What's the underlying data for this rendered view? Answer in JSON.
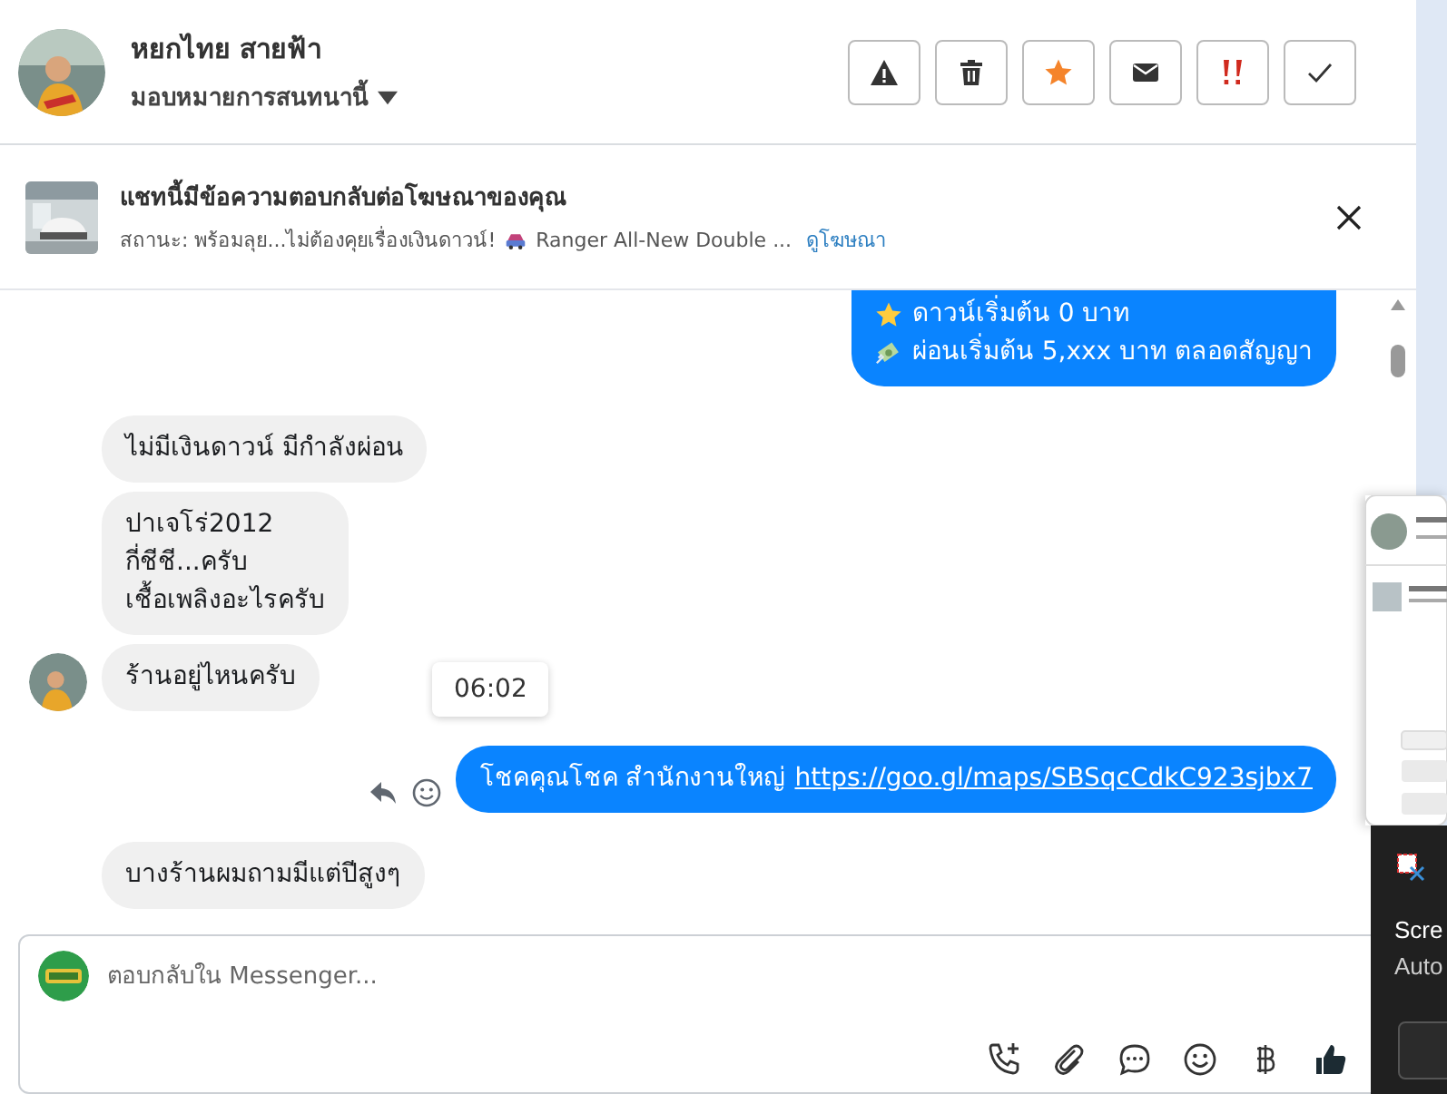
{
  "header": {
    "name": "หยกไทย สายฟ้า",
    "assign": "มอบหมายการสนทนานี้",
    "actions": [
      {
        "kind": "spam"
      },
      {
        "kind": "trash"
      },
      {
        "kind": "star"
      },
      {
        "kind": "mail"
      },
      {
        "kind": "important"
      },
      {
        "kind": "done"
      }
    ]
  },
  "ad_banner": {
    "title": "แชทนี้มีข้อความตอบกลับต่อโฆษณาของคุณ",
    "status": "สถานะ: พร้อมลุย...ไม่ต้องคุยเรื่องเงินดาวน์!",
    "ad_name": "Ranger All-New Double ...",
    "link": "ดูโฆษณา"
  },
  "messages": [
    {
      "kind": "sent",
      "lines": [
        {
          "kind": "star",
          "text": "ดาวน์เริ่มต้น 0 บาท"
        },
        {
          "kind": "money",
          "text": "ผ่อนเริ่มต้น 5,xxx บาท ตลอดสัญญา"
        }
      ]
    },
    {
      "kind": "received",
      "avatar": false,
      "lines": [
        {
          "text": "ไม่มีเงินดาวน์ มีกำลังผ่อน"
        }
      ]
    },
    {
      "kind": "received",
      "avatar": false,
      "lines": [
        {
          "text": "ปาเจโร่2012"
        },
        {
          "text": "กี่ชีชี...ครับ"
        },
        {
          "text": "เชื้อเพลิงอะไรครับ"
        }
      ]
    },
    {
      "kind": "received",
      "avatar": true,
      "lines": [
        {
          "text": "ร้านอยู่ไหนครับ"
        }
      ],
      "tooltip": "06:02"
    },
    {
      "kind": "sent",
      "hover_actions": true,
      "lines": [
        {
          "text": "โชคคุณโชค สำนักงานใหญ่",
          "link": "https://goo.gl/maps/SBSqcCdkC923sjbx7"
        }
      ]
    },
    {
      "kind": "received",
      "avatar": false,
      "lines": [
        {
          "text": "บางร้านผมถามมีแต่ปีสูงๆ"
        }
      ]
    }
  ],
  "composer": {
    "placeholder": "ตอบกลับใน Messenger...",
    "tools": [
      {
        "kind": "call"
      },
      {
        "kind": "attach"
      },
      {
        "kind": "saved-reply"
      },
      {
        "kind": "emoji"
      },
      {
        "kind": "baht"
      },
      {
        "kind": "like"
      }
    ]
  },
  "notification": {
    "title": "Scre",
    "subtitle": "Auto"
  }
}
